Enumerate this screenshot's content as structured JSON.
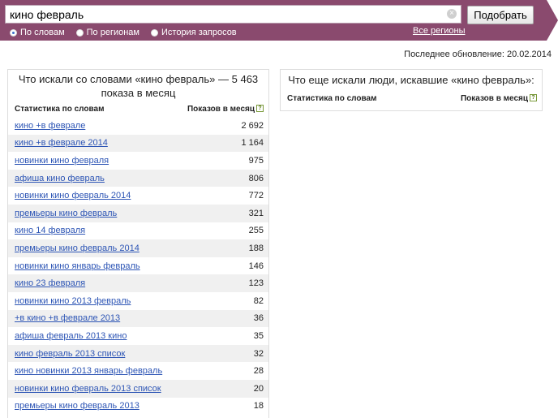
{
  "search": {
    "query": "кино февраль",
    "submit_label": "Подобрать",
    "clear_icon": "×"
  },
  "modes": [
    {
      "label": "По словам",
      "selected": true
    },
    {
      "label": "По регионам",
      "selected": false
    },
    {
      "label": "История запросов",
      "selected": false
    }
  ],
  "regions_link": "Все регионы",
  "last_update": "Последнее обновление: 20.02.2014",
  "left_panel": {
    "title": "Что искали со словами «кино февраль» — 5 463 показа в месяц",
    "col_phrase": "Статистика по словам",
    "col_count": "Показов в месяц",
    "help_icon": "?",
    "rows": [
      {
        "phrase": "кино +в феврале",
        "count": "2 692"
      },
      {
        "phrase": "кино +в феврале 2014",
        "count": "1 164"
      },
      {
        "phrase": "новинки кино февраля",
        "count": "975"
      },
      {
        "phrase": "афиша кино февраль",
        "count": "806"
      },
      {
        "phrase": "новинки кино февраль 2014",
        "count": "772"
      },
      {
        "phrase": "премьеры кино февраль",
        "count": "321"
      },
      {
        "phrase": "кино 14 февраля",
        "count": "255"
      },
      {
        "phrase": "премьеры кино февраль 2014",
        "count": "188"
      },
      {
        "phrase": "новинки кино январь февраль",
        "count": "146"
      },
      {
        "phrase": "кино 23 февраля",
        "count": "123"
      },
      {
        "phrase": "новинки кино 2013 февраль",
        "count": "82"
      },
      {
        "phrase": "+в кино +в феврале 2013",
        "count": "36"
      },
      {
        "phrase": "афиша февраль 2013 кино",
        "count": "35"
      },
      {
        "phrase": "кино февраль 2013 список",
        "count": "32"
      },
      {
        "phrase": "кино новинки 2013 январь февраль",
        "count": "28"
      },
      {
        "phrase": "новинки кино февраль 2013 список",
        "count": "20"
      },
      {
        "phrase": "премьеры кино февраль 2013",
        "count": "18"
      }
    ]
  },
  "right_panel": {
    "title": "Что еще искали люди, искавшие «кино февраль»:",
    "col_phrase": "Статистика по словам",
    "col_count": "Показов в месяц",
    "help_icon": "?"
  }
}
